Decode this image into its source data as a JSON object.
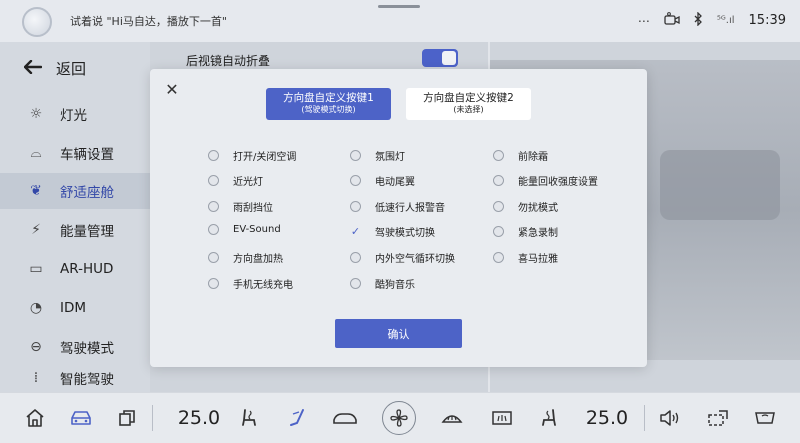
{
  "status_bar": {
    "voice_hint": "试着说 \"Hi马自达，播放下一首\"",
    "menu_dots": "⋯",
    "camera_icon": "camera-icon",
    "bluetooth_icon": "bluetooth-icon",
    "signal_text": "⁵ᴳ.ıl",
    "time": "15:39"
  },
  "sidebar": {
    "back_label": "返回",
    "items": [
      {
        "label": "灯光",
        "icon": "☼",
        "active": false
      },
      {
        "label": "车辆设置",
        "icon": "⌓",
        "active": false
      },
      {
        "label": "舒适座舱",
        "icon": "❦",
        "active": true
      },
      {
        "label": "能量管理",
        "icon": "⚡",
        "active": false
      },
      {
        "label": "AR-HUD",
        "icon": "▭",
        "active": false
      },
      {
        "label": "IDM",
        "icon": "◔",
        "active": false
      },
      {
        "label": "驾驶模式",
        "icon": "⊖",
        "active": false
      },
      {
        "label": "智能驾驶",
        "icon": "⁞",
        "active": false
      }
    ]
  },
  "background": {
    "row_label": "后视镜自动折叠",
    "toggle_on": true
  },
  "modal": {
    "close_icon": "✕",
    "tabs": [
      {
        "title": "方向盘自定义按键1",
        "subtitle": "(驾驶模式切换)",
        "active": true
      },
      {
        "title": "方向盘自定义按键2",
        "subtitle": "(未选择)",
        "active": false
      }
    ],
    "options": [
      [
        "打开/关闭空调",
        "氛围灯",
        "前除霜"
      ],
      [
        "近光灯",
        "电动尾翼",
        "能量回收强度设置"
      ],
      [
        "雨刮挡位",
        "低速行人报警音",
        "勿扰模式"
      ],
      [
        "EV-Sound",
        "驾驶模式切换",
        "紧急录制"
      ],
      [
        "方向盘加热",
        "内外空气循环切换",
        "喜马拉雅"
      ],
      [
        "手机无线充电",
        "酷狗音乐",
        ""
      ]
    ],
    "selected_option": "驾驶模式切换",
    "confirm_label": "确认"
  },
  "dock": {
    "left_temp": "25.0",
    "right_temp": "25.0"
  },
  "colors": {
    "accent": "#4d63c7",
    "modal_bg": "#e9ecf0"
  }
}
